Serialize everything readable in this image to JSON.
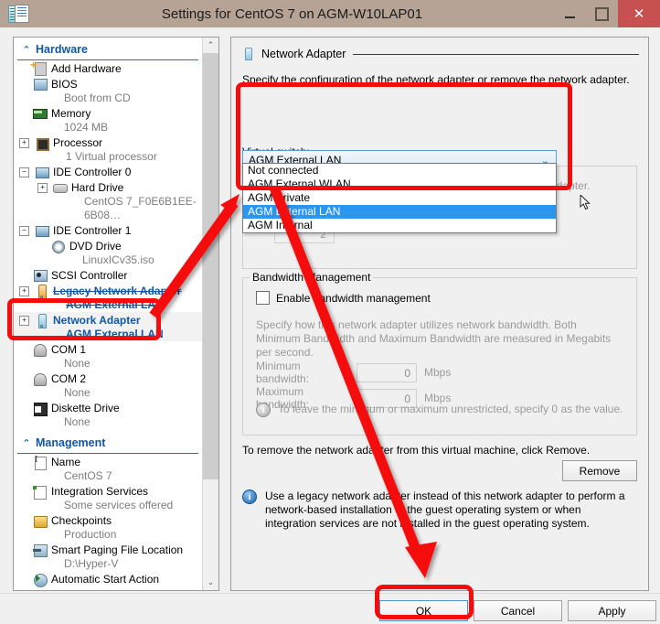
{
  "window": {
    "title": "Settings for CentOS 7 on AGM-W10LAP01",
    "icon": "settings-document-icon",
    "minimize_label": "Minimize",
    "maximize_label": "Maximize",
    "close_label": "✕"
  },
  "sidebar": {
    "sections": [
      {
        "title": "Hardware",
        "chevron": "⌃",
        "items": [
          {
            "label": "Add Hardware",
            "sub": "",
            "icon": "add-hardware-icon",
            "expander": "",
            "indent": 0
          },
          {
            "label": "BIOS",
            "sub": "Boot from CD",
            "icon": "bios-icon",
            "expander": "",
            "indent": 0
          },
          {
            "label": "Memory",
            "sub": "1024 MB",
            "icon": "memory-icon",
            "expander": "",
            "indent": 0
          },
          {
            "label": "Processor",
            "sub": "1 Virtual processor",
            "icon": "processor-icon",
            "expander": "+",
            "indent": 0
          },
          {
            "label": "IDE Controller 0",
            "sub": "",
            "icon": "ide-controller-icon",
            "expander": "−",
            "indent": 0
          },
          {
            "label": "Hard Drive",
            "sub": "CentOS 7_F0E6B1EE-6B08…",
            "icon": "hard-drive-icon",
            "expander": "+",
            "indent": 1
          },
          {
            "label": "IDE Controller 1",
            "sub": "",
            "icon": "ide-controller-icon",
            "expander": "−",
            "indent": 0
          },
          {
            "label": "DVD Drive",
            "sub": "LinuxICv35.iso",
            "icon": "dvd-drive-icon",
            "expander": "",
            "indent": 1
          },
          {
            "label": "SCSI Controller",
            "sub": "",
            "icon": "scsi-controller-icon",
            "expander": "",
            "indent": 0
          },
          {
            "label": "Legacy Network Adapter",
            "sub": "AGM External LAN",
            "icon": "legacy-network-adapter-icon",
            "expander": "+",
            "indent": 0,
            "style": "blue-strike"
          },
          {
            "label": "Network Adapter",
            "sub": "AGM External LAN",
            "icon": "network-adapter-icon",
            "expander": "+",
            "indent": 0,
            "style": "blue-selected"
          },
          {
            "label": "COM 1",
            "sub": "None",
            "icon": "com-port-icon",
            "expander": "",
            "indent": 0
          },
          {
            "label": "COM 2",
            "sub": "None",
            "icon": "com-port-icon",
            "expander": "",
            "indent": 0
          },
          {
            "label": "Diskette Drive",
            "sub": "None",
            "icon": "diskette-drive-icon",
            "expander": "",
            "indent": 0
          }
        ]
      },
      {
        "title": "Management",
        "chevron": "⌃",
        "items": [
          {
            "label": "Name",
            "sub": "CentOS 7",
            "icon": "name-icon",
            "expander": "",
            "indent": 0
          },
          {
            "label": "Integration Services",
            "sub": "Some services offered",
            "icon": "integration-services-icon",
            "expander": "",
            "indent": 0
          },
          {
            "label": "Checkpoints",
            "sub": "Production",
            "icon": "checkpoints-icon",
            "expander": "",
            "indent": 0
          },
          {
            "label": "Smart Paging File Location",
            "sub": "D:\\Hyper-V",
            "icon": "smart-paging-icon",
            "expander": "",
            "indent": 0
          },
          {
            "label": "Automatic Start Action",
            "sub": "",
            "icon": "automatic-start-icon",
            "expander": "",
            "indent": 0
          }
        ]
      }
    ],
    "scroll_up": "⌃",
    "scroll_down": "⌄"
  },
  "panel": {
    "header": "Network Adapter",
    "header_icon": "network-adapter-icon",
    "description": "Specify the configuration of the network adapter or remove the network adapter.",
    "virtual_switch": {
      "label": "Virtual switch:",
      "selected": "AGM External LAN",
      "arrow": "⌄",
      "options": [
        "Not connected",
        "AGM External WLAN",
        "AGM Private",
        "AGM External LAN",
        "AGM Internal"
      ],
      "highlighted_option": "AGM External LAN"
    },
    "vlan": {
      "partial_text": "will use for all network communications through this network adapter.",
      "vlan_id_value": "2"
    },
    "bandwidth": {
      "group_title": "Bandwidth Management",
      "enable_label": "Enable bandwidth management",
      "enabled": false,
      "description": "Specify how this network adapter utilizes network bandwidth. Both Minimum Bandwidth and Maximum Bandwidth are measured in Megabits per second.",
      "minimum_label": "Minimum bandwidth:",
      "minimum_value": "0",
      "maximum_label": "Maximum bandwidth:",
      "maximum_value": "0",
      "unit": "Mbps",
      "note": "To leave the minimum or maximum unrestricted, specify 0 as the value.",
      "note_icon": "info-icon"
    },
    "remove": {
      "text": "To remove the network adapter from this virtual machine, click Remove.",
      "button_label": "Remove"
    },
    "legacy_note": {
      "icon": "info-icon",
      "text": "Use a legacy network adapter instead of this network adapter to perform a network-based installation of the guest operating system or when integration services are not installed in the guest operating system."
    }
  },
  "buttons": {
    "ok": "OK",
    "cancel": "Cancel",
    "apply": "Apply"
  },
  "annotations": {
    "accent_color": "#f50d0d",
    "highlight_network_adapter": "red-box-around-network-adapter",
    "highlight_dropdown": "red-box-around-virtual-switch-dropdown",
    "highlight_ok": "red-box-around-ok-button",
    "arrow_1": "arrow-from-network-adapter-to-dropdown",
    "arrow_2": "arrow-from-dropdown-to-ok-button"
  },
  "colors": {
    "titlebar": "#b6a396",
    "close_button": "#c75050",
    "sidebar_link": "#1257a5",
    "selection": "#2b96ef",
    "combo_border": "#5a9ed6"
  }
}
